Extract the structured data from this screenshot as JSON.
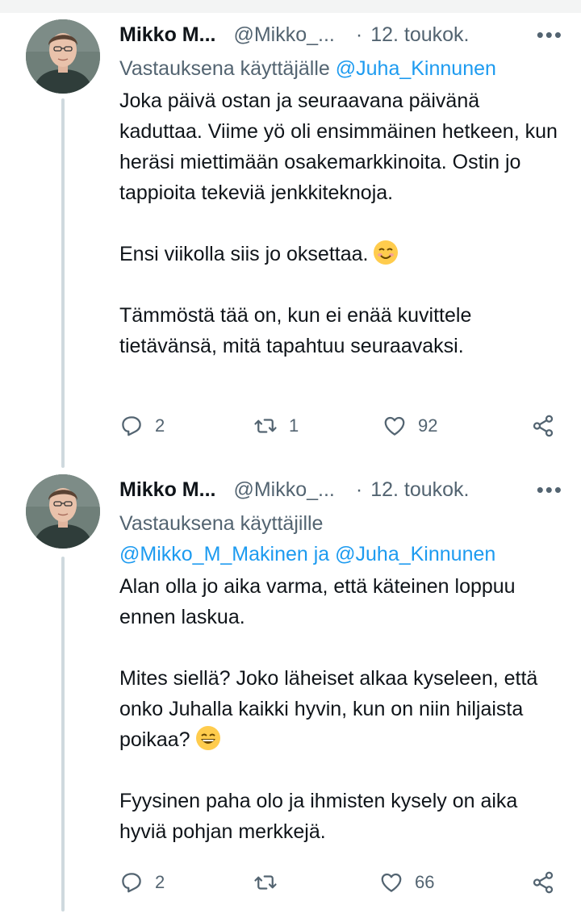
{
  "tweets": [
    {
      "name": "Mikko M...",
      "handle": "@Mikko_...",
      "dot": "·",
      "date": "12. toukok.",
      "more": "•••",
      "reply_prefix": "Vastauksena käyttäjälle",
      "reply_mentions": "@Juha_Kinnunen",
      "paragraphs": [
        "Joka päivä ostan ja seuraavana päivänä kaduttaa. Viime yö oli ensimmäinen hetkeen, kun heräsi miettimään osakemarkkinoita. Ostin jo tappioita tekeviä jenkkiteknoja.",
        "Ensi viikolla siis jo oksettaa.",
        "Tämmöstä tää on, kun ei enää kuvittele tietävänsä, mitä tapahtuu seuraavaksi."
      ],
      "emoji_icon": "smiling-face-with-smiling-eyes-icon",
      "replies": "2",
      "retweets": "1",
      "likes": "92"
    },
    {
      "name": "Mikko M...",
      "handle": "@Mikko_...",
      "dot": "·",
      "date": "12. toukok.",
      "more": "•••",
      "reply_prefix": "Vastauksena käyttäjille",
      "reply_mentions": "@Mikko_M_Makinen ja @Juha_Kinnunen",
      "paragraphs": [
        "Alan olla jo aika varma, että käteinen loppuu ennen laskua.",
        "Mites siellä? Joko läheiset alkaa kyseleen, että onko Juhalla kaikki hyvin, kun on niin hiljaista poikaa?",
        "Fyysinen paha olo ja ihmisten kysely on aika hyviä pohjan merkkejä."
      ],
      "emoji_icon": "grinning-face-with-smiling-eyes-icon",
      "replies": "2",
      "retweets": "",
      "likes": "66"
    }
  ],
  "colors": {
    "text": "#0f1419",
    "secondary": "#536471",
    "link": "#1d9bf0",
    "thread_line": "#cfd9de"
  },
  "icons": {
    "reply": "reply-bubble-icon",
    "retweet": "retweet-icon",
    "like": "heart-icon",
    "share": "share-icon",
    "more": "more-icon"
  }
}
